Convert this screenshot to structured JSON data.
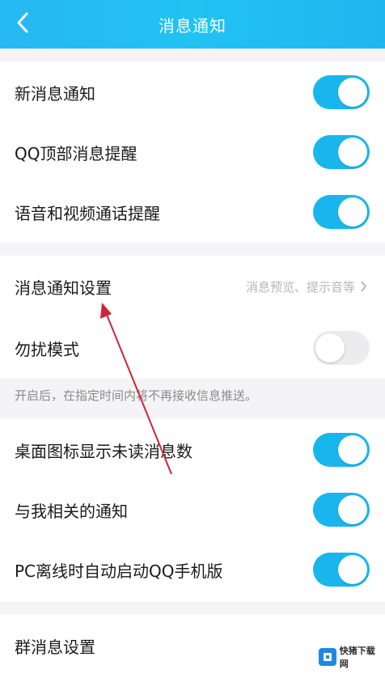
{
  "header": {
    "title": "消息通知"
  },
  "group1": [
    {
      "label": "新消息通知",
      "on": true
    },
    {
      "label": "QQ顶部消息提醒",
      "on": true
    },
    {
      "label": "语音和视频通话提醒",
      "on": true
    }
  ],
  "group2": {
    "settings_label": "消息通知设置",
    "settings_sub": "消息预览、提示音等",
    "dnd_label": "勿扰模式",
    "dnd_on": false
  },
  "note": "开启后，在指定时间内将不再接收信息推送。",
  "group3": [
    {
      "label": "桌面图标显示未读消息数",
      "on": true
    },
    {
      "label": "与我相关的通知",
      "on": true
    },
    {
      "label": "PC离线时自动启动QQ手机版",
      "on": true
    }
  ],
  "group4": {
    "label": "群消息设置"
  },
  "watermark": {
    "text": "快猪下载网"
  },
  "colors": {
    "accent": "#19b6ee",
    "header": "#22c2f3",
    "annotation_arrow": "#d0243a"
  }
}
